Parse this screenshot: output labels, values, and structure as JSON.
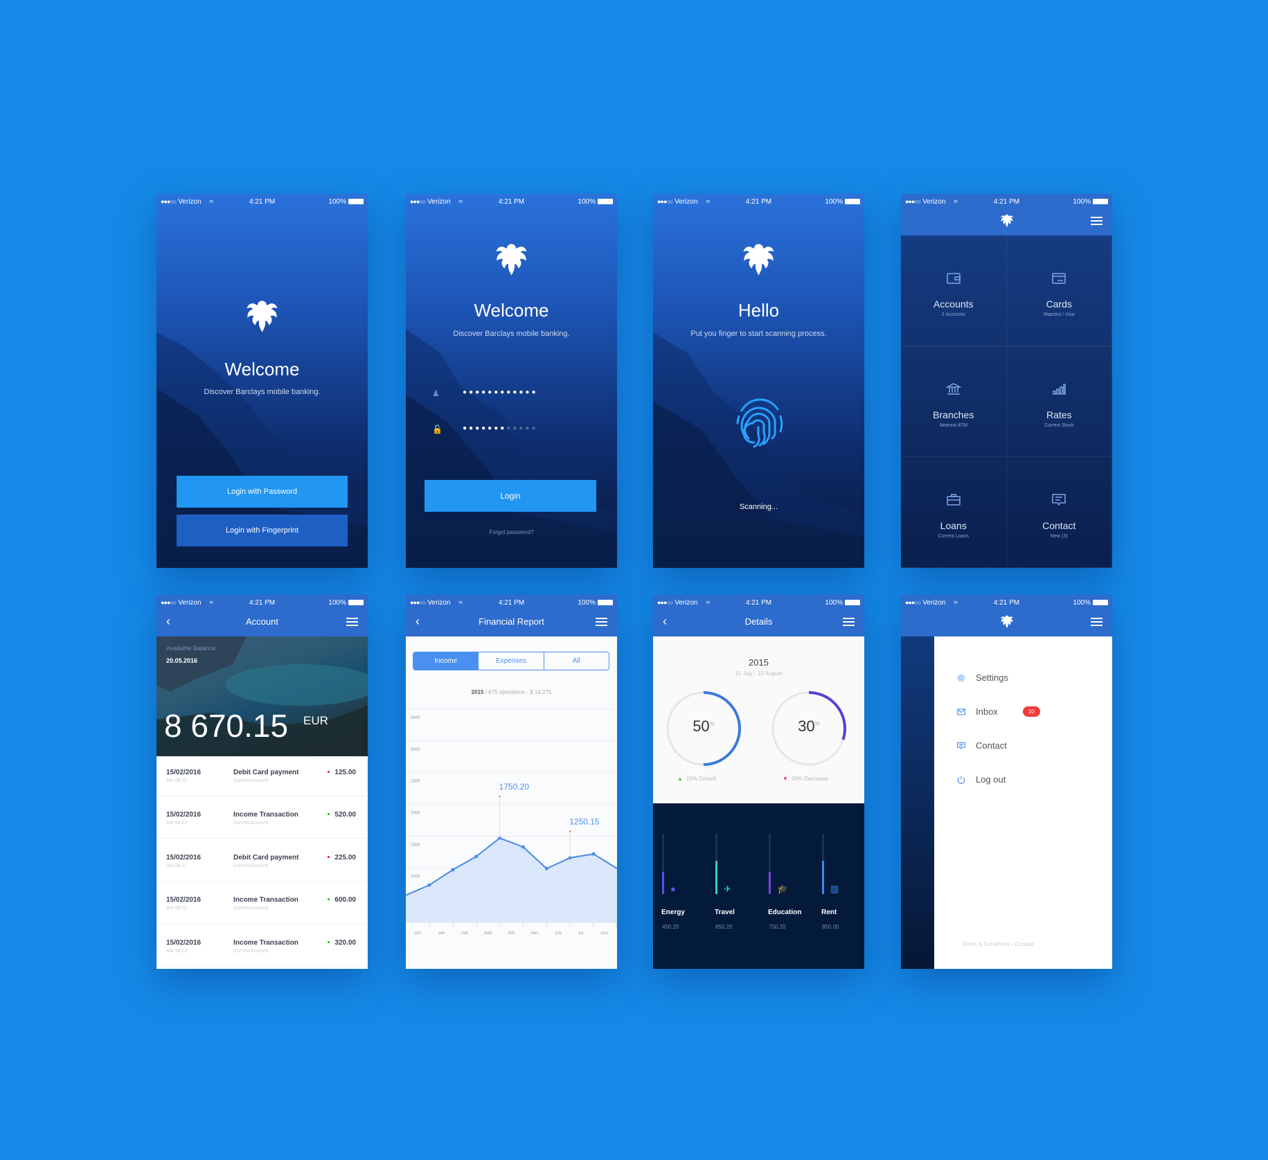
{
  "colors": {
    "background": "#1589e7",
    "header": "#2d6bcc",
    "button": "#2196f3",
    "positive": "#2ecc40",
    "negative": "#ff2d55",
    "badge": "#f23a3a"
  },
  "status_bar": {
    "carrier": "Verizon",
    "time": "4:21 PM",
    "battery": "100%"
  },
  "welcome": {
    "title": "Welcome",
    "subtitle": "Discover Barclays mobile banking.",
    "login_password": "Login with Password",
    "login_fingerprint": "Login with Fingerprint"
  },
  "login": {
    "title": "Welcome",
    "subtitle": "Discover Barclays mobile banking.",
    "username_value": "●●●●●●●●●●●●",
    "password_value": "●●●●●●●",
    "password_placeholder": "●●●●●",
    "login_button": "Login",
    "forgot": "Forgot password?"
  },
  "fingerprint": {
    "title": "Hello",
    "subtitle": "Put you finger to start scanning process.",
    "status": "Scanning..."
  },
  "dashboard": {
    "items": [
      {
        "icon": "wallet-icon",
        "title": "Accounts",
        "sub": "2 Accounts"
      },
      {
        "icon": "credit-card-icon",
        "title": "Cards",
        "sub": "Maestro / Visa"
      },
      {
        "icon": "bank-icon",
        "title": "Branches",
        "sub": "Nearest ATM"
      },
      {
        "icon": "bar-chart-icon",
        "title": "Rates",
        "sub": "Current Stock"
      },
      {
        "icon": "briefcase-icon",
        "title": "Loans",
        "sub": "Current Loans"
      },
      {
        "icon": "chat-icon",
        "title": "Contact",
        "sub": "New (3)"
      }
    ]
  },
  "account": {
    "title": "Account",
    "balance_label": "Available Balance",
    "date": "20.05.2016",
    "balance": "8 670.15",
    "currency": "EUR",
    "transactions": [
      {
        "date": "15/02/2016",
        "time": "AM 08:22",
        "name": "Debit Card payment",
        "account": "Current Account",
        "amount": "125.00",
        "type": "debit"
      },
      {
        "date": "15/02/2016",
        "time": "AM 08:22",
        "name": "Income Transaction",
        "account": "Current Account",
        "amount": "520.00",
        "type": "credit"
      },
      {
        "date": "15/02/2016",
        "time": "AM 08:22",
        "name": "Debit Card payment",
        "account": "Current Account",
        "amount": "225.00",
        "type": "debit"
      },
      {
        "date": "15/02/2016",
        "time": "AM 08:22",
        "name": "Income Transaction",
        "account": "Current Account",
        "amount": "600.00",
        "type": "credit"
      },
      {
        "date": "15/02/2016",
        "time": "AM 08:22",
        "name": "Income Transaction",
        "account": "Current Account",
        "amount": "320.00",
        "type": "credit"
      }
    ]
  },
  "report": {
    "title": "Financial Report",
    "tabs": [
      "Income",
      "Expenses",
      "All"
    ],
    "active_tab": 0,
    "year": "2015",
    "summary": "675 operations - $ 14,275"
  },
  "chart_data": {
    "type": "area",
    "y_ticks": [
      "3500",
      "3000",
      "2500",
      "2000",
      "1500",
      "1000",
      "500"
    ],
    "ylim": [
      500,
      3500
    ],
    "x_ticks": [
      "DEC",
      "JAN",
      "FEB",
      "MAR",
      "APR",
      "MAY",
      "JUN",
      "JUL",
      "AUG"
    ],
    "values": [
      700,
      860,
      1100,
      1310,
      1600,
      1460,
      1120,
      1290,
      1350,
      1120
    ],
    "annotations": [
      {
        "index": 4,
        "label": "1750.20"
      },
      {
        "index": 7,
        "label": "1250.15"
      }
    ],
    "grid": true
  },
  "details": {
    "title": "Details",
    "year": "2015",
    "range": "10 July - 10 August",
    "gauges": [
      {
        "value": "50",
        "unit": "%",
        "fraction": 0.5,
        "color": "#3a7bdc",
        "note": "15% Growth",
        "trend": "up"
      },
      {
        "value": "30",
        "unit": "%",
        "fraction": 0.3,
        "color": "#5b3fd0",
        "note": "30% Decrease",
        "trend": "down"
      }
    ],
    "categories": [
      {
        "name": "Energy",
        "value": "450.20",
        "fraction": 0.37,
        "color": "#5b4ee8",
        "icon": "lightbulb-icon"
      },
      {
        "name": "Travel",
        "value": "850.20",
        "fraction": 0.55,
        "color": "#35d0c0",
        "icon": "airplane-icon"
      },
      {
        "name": "Education",
        "value": "750.20",
        "fraction": 0.37,
        "color": "#7a45e0",
        "icon": "graduation-cap-icon"
      },
      {
        "name": "Rent",
        "value": "850.00",
        "fraction": 0.55,
        "color": "#3a8cf0",
        "icon": "building-icon"
      }
    ]
  },
  "side_menu": {
    "items": [
      {
        "icon": "gear-icon",
        "label": "Settings"
      },
      {
        "icon": "mail-icon",
        "label": "Inbox",
        "badge": "10"
      },
      {
        "icon": "chat-icon",
        "label": "Contact"
      },
      {
        "icon": "power-icon",
        "label": "Log out"
      }
    ],
    "footer_terms": "Terms & Conditions",
    "footer_sep": "•",
    "footer_contact": "Contact"
  }
}
